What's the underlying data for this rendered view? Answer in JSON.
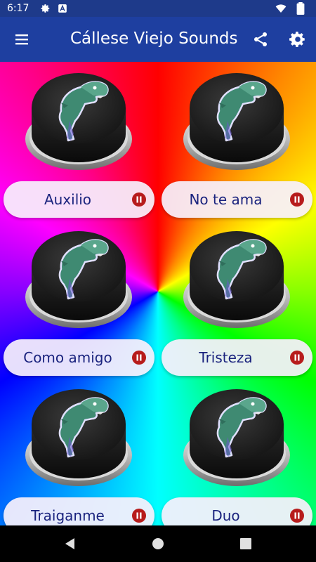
{
  "status_bar": {
    "time": "6:17",
    "icons": [
      "gear-icon",
      "font-a-icon",
      "wifi-icon",
      "battery-icon"
    ]
  },
  "app_bar": {
    "title": "Cállese Viejo Sounds",
    "icons": [
      "menu-icon",
      "share-icon",
      "settings-icon"
    ]
  },
  "sounds": [
    {
      "label": "Auxilio"
    },
    {
      "label": "No te ama"
    },
    {
      "label": "Como amigo"
    },
    {
      "label": "Tristeza"
    },
    {
      "label": "Traiganme"
    },
    {
      "label": "Duo"
    }
  ],
  "colors": {
    "app_bar": "#1e3fa0",
    "status_bar": "#1e3a8a",
    "label_text": "#1a237e",
    "pause_icon": "#b71c1c",
    "pill_bg": "#f8f0fc"
  },
  "nav_bar": {
    "icons": [
      "back-icon",
      "home-icon",
      "recents-icon"
    ]
  }
}
